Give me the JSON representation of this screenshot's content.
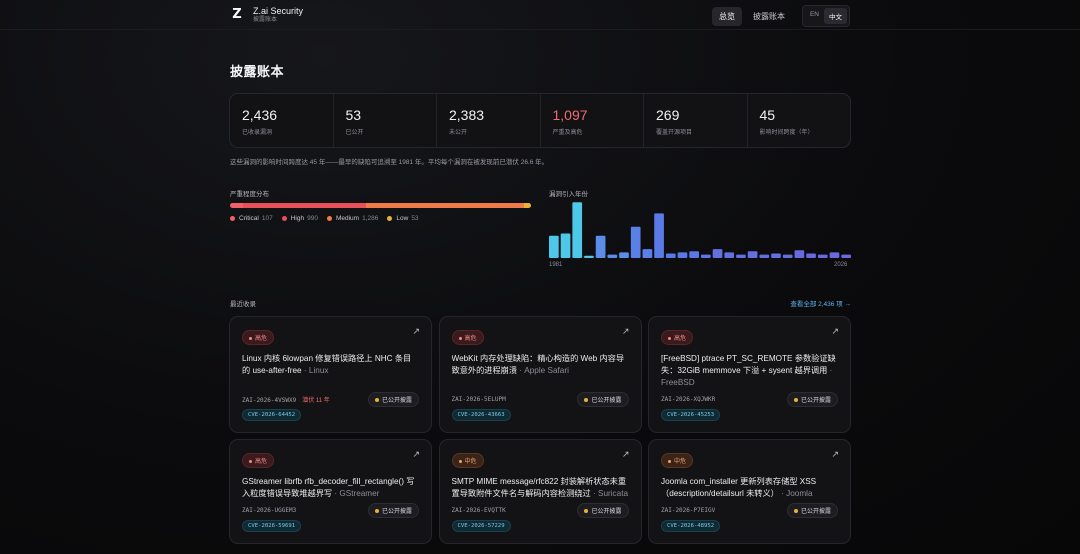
{
  "header": {
    "brand_name": "Z.ai Security",
    "brand_sub": "披露账本",
    "logo_glyph": "Z",
    "nav": [
      "总览",
      "披露账本"
    ],
    "active_nav": 0,
    "lang": [
      "EN",
      "中文"
    ],
    "active_lang": 1
  },
  "page_title": "披露账本",
  "stats": [
    {
      "value": "2,436",
      "label": "已收录漏洞",
      "danger": false
    },
    {
      "value": "53",
      "label": "已公开",
      "danger": false
    },
    {
      "value": "2,383",
      "label": "未公开",
      "danger": false
    },
    {
      "value": "1,097",
      "label": "严重及高危",
      "danger": true
    },
    {
      "value": "269",
      "label": "覆盖开源项目",
      "danger": false
    },
    {
      "value": "45",
      "label": "影响时间跨度（年）",
      "danger": false
    }
  ],
  "summary": "这些漏洞的影响时间跨度达 45 年——最早的缺陷可追溯至 1981 年。平均每个漏洞在被发现前已潜伏 26.6 年。",
  "severity": {
    "title": "严重程度分布",
    "items": [
      {
        "name": "Critical",
        "count": "107",
        "value": 107,
        "color": "#f0606a"
      },
      {
        "name": "High",
        "count": "990",
        "value": 990,
        "color": "#e8505a"
      },
      {
        "name": "Medium",
        "count": "1,286",
        "value": 1286,
        "color": "#f07a4a"
      },
      {
        "name": "Low",
        "count": "53",
        "value": 53,
        "color": "#e9b233"
      }
    ]
  },
  "chart_data": {
    "type": "bar",
    "title": "漏洞引入年份",
    "x_start_label": "1981",
    "x_end_label": "2026",
    "values": [
      20,
      22,
      50,
      2,
      20,
      3,
      5,
      28,
      8,
      40,
      4,
      5,
      6,
      3,
      8,
      5,
      3,
      6,
      3,
      4,
      3,
      7,
      4,
      3,
      5,
      3
    ],
    "colors": [
      "#4ec8e8",
      "#4ec8e8",
      "#4ec8e8",
      "#4ec8e8",
      "#5a8ce8",
      "#5a8ce8",
      "#5a8ce8",
      "#5a80e8",
      "#5a80e8",
      "#5a7ae8",
      "#5a78e8",
      "#5a78e8",
      "#5a78e8",
      "#5a78e8",
      "#6270e0",
      "#6270e0",
      "#6270e0",
      "#6270e0",
      "#6270e0",
      "#6270e0",
      "#6270e0",
      "#6a6ae0",
      "#6a6ae0",
      "#6a6ae0",
      "#6a6ae0",
      "#6a6ae0"
    ],
    "ylim": [
      0,
      52
    ]
  },
  "recent": {
    "title": "最近收录",
    "view_all": "查看全部 2,436 项 →",
    "cards": [
      {
        "severity": "高危",
        "level": "high",
        "title": "Linux 内核 6lowpan 修复错误路径上 NHC 条目的 use-after-free",
        "vendor": "Linux",
        "id": "ZAI-2026-4VSWX9",
        "lurk": "潜伏 11 年",
        "status": "已公开披露",
        "cve": "CVE-2026-64452"
      },
      {
        "severity": "高危",
        "level": "high",
        "title": "WebKit 内存处理缺陷：精心构造的 Web 内容导致意外的进程崩溃",
        "vendor": "Apple Safari",
        "id": "ZAI-2026-5ELUPM",
        "lurk": "",
        "status": "已公开披露",
        "cve": "CVE-2026-43663"
      },
      {
        "severity": "高危",
        "level": "high",
        "title": "[FreeBSD] ptrace PT_SC_REMOTE 参数验证缺失：32GiB memmove 下溢 + sysent 越界调用",
        "vendor": "FreeBSD",
        "id": "ZAI-2026-XQJWKR",
        "lurk": "",
        "status": "已公开披露",
        "cve": "CVE-2026-45253"
      },
      {
        "severity": "高危",
        "level": "high",
        "title": "GStreamer librfb rfb_decoder_fill_rectangle() 写入粒度错误导致堆越界写",
        "vendor": "GStreamer",
        "id": "ZAI-2026-UGGEM3",
        "lurk": "",
        "status": "已公开披露",
        "cve": "CVE-2026-59691"
      },
      {
        "severity": "中危",
        "level": "medium",
        "title": "SMTP MIME message/rfc822 封装解析状态未重置导致附件文件名与解码内容检测绕过",
        "vendor": "Suricata",
        "id": "ZAI-2026-EVQTTK",
        "lurk": "",
        "status": "已公开披露",
        "cve": "CVE-2026-57229"
      },
      {
        "severity": "中危",
        "level": "medium",
        "title": "Joomla com_installer 更新列表存储型 XSS（description/detailsurl 未转义）",
        "vendor": "Joomla",
        "id": "ZAI-2026-P7EIGV",
        "lurk": "",
        "status": "已公开披露",
        "cve": "CVE-2026-48952"
      }
    ]
  }
}
